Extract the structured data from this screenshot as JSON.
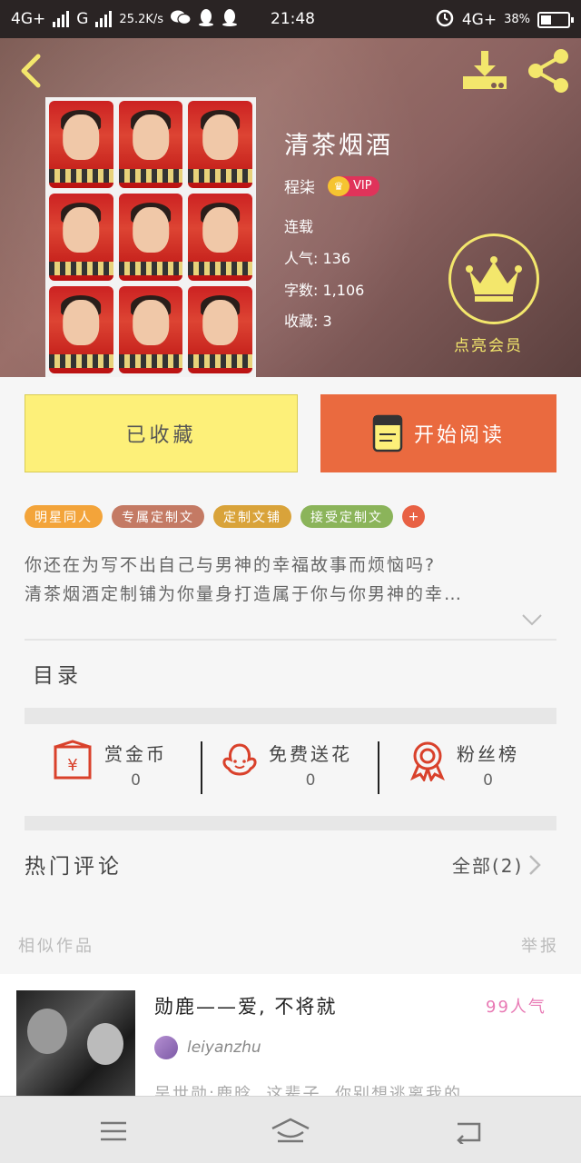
{
  "status_bar": {
    "network_left": "4G+",
    "network_g": "G",
    "speed": "25.2K/s",
    "time": "21:48",
    "network_right": "4G+",
    "battery": "38%",
    "battery_level": 0.38
  },
  "book": {
    "title": "清茶烟酒",
    "author": "程柒",
    "vip_label": "VIP",
    "status": "连载",
    "popularity_label": "人气:",
    "popularity": "136",
    "wordcount_label": "字数:",
    "wordcount": "1,106",
    "favorites_label": "收藏:",
    "favorites": "3",
    "member_label": "点亮会员"
  },
  "actions": {
    "favorited_label": "已收藏",
    "start_read_label": "开始阅读"
  },
  "tags": [
    {
      "label": "明星同人",
      "color": "#f3a43a"
    },
    {
      "label": "专属定制文",
      "color": "#c47a64"
    },
    {
      "label": "定制文铺",
      "color": "#d9a33a"
    },
    {
      "label": "接受定制文",
      "color": "#8bb45a"
    }
  ],
  "tag_more": "+",
  "description": {
    "line1": "你还在为写不出自己与男神的幸福故事而烦恼吗?",
    "line2": "清茶烟酒定制铺为你量身打造属于你与你男神的幸…"
  },
  "catalog_label": "目录",
  "stats": [
    {
      "label": "赏金币",
      "value": "0",
      "icon": "red-envelope-icon"
    },
    {
      "label": "免费送花",
      "value": "0",
      "icon": "flower-icon"
    },
    {
      "label": "粉丝榜",
      "value": "0",
      "icon": "medal-icon"
    }
  ],
  "comments": {
    "title": "热门评论",
    "all_label": "全部(2)"
  },
  "similar": {
    "title": "相似作品",
    "report_label": "举报",
    "item": {
      "title": "勋鹿——爱, 不将就",
      "popularity": "99人气",
      "author": "leiyanzhu",
      "snippet": "吴世勋:鹿晗, 这辈子, 你别想逃离我的…"
    }
  },
  "colors": {
    "accent_yellow": "#fdf079",
    "accent_orange": "#ea6a3f",
    "member_gold": "#f3e76c"
  }
}
